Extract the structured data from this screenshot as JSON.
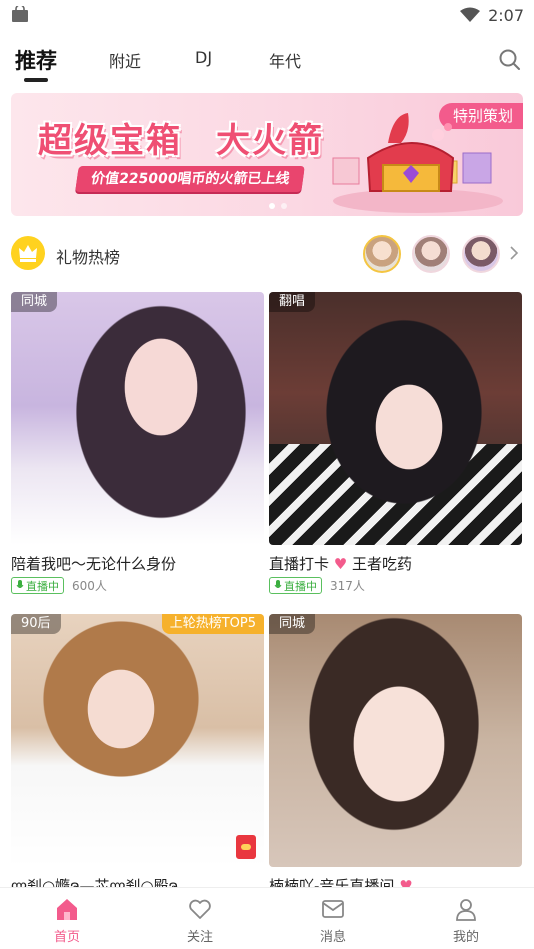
{
  "status_bar": {
    "time": "2:07"
  },
  "tabs": [
    {
      "label": "推荐",
      "active": true
    },
    {
      "label": "附近"
    },
    {
      "label": "DJ"
    },
    {
      "label": "年代"
    }
  ],
  "banner": {
    "title": "超级宝箱",
    "title2": "大火箭",
    "subtitle": "价值225000唱币的火箭已上线",
    "tag": "特别策划"
  },
  "gift_rank": {
    "label": "礼物热榜"
  },
  "cards": [
    {
      "tag": "同城",
      "title": "陪着我吧～无论什么身份",
      "live": "直播中",
      "viewers": "600人"
    },
    {
      "tag": "翻唱",
      "title": "直播打卡",
      "title_after": "王者吃药",
      "live": "直播中",
      "viewers": "317人"
    },
    {
      "tag": "90后",
      "hot": "上轮热榜TOP5",
      "title": "ლ刹○嫷ຈ—芯ლ刹○殿ຈ"
    },
    {
      "tag": "同城",
      "title": "楠楠吖-音乐直播间"
    }
  ],
  "bottom_nav": [
    {
      "label": "首页",
      "active": true
    },
    {
      "label": "关注"
    },
    {
      "label": "消息"
    },
    {
      "label": "我的"
    }
  ],
  "colors": {
    "accent": "#f35b8c",
    "live_green": "#3aae3f",
    "crown": "#ffd21f"
  }
}
